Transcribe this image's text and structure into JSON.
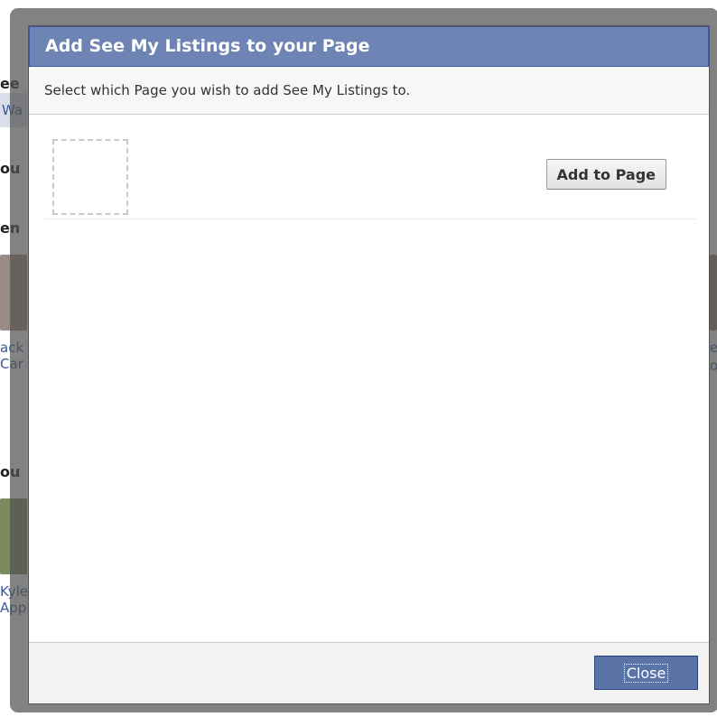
{
  "background_page": {
    "fragments": [
      "ee",
      "Wa",
      "ou",
      "en",
      "ack",
      "Car",
      "ou",
      "Kyle",
      "App",
      "e",
      "o"
    ]
  },
  "dialog": {
    "title": "Add See My Listings to your Page",
    "subtitle": "Select which Page you wish to add See My Listings to.",
    "pages": [
      {
        "add_label": "Add to Page"
      }
    ],
    "close_label": "Close"
  },
  "colors": {
    "title_bar": "#6d84b4",
    "primary_button": "#5b74a8",
    "overlay": "#525252"
  }
}
